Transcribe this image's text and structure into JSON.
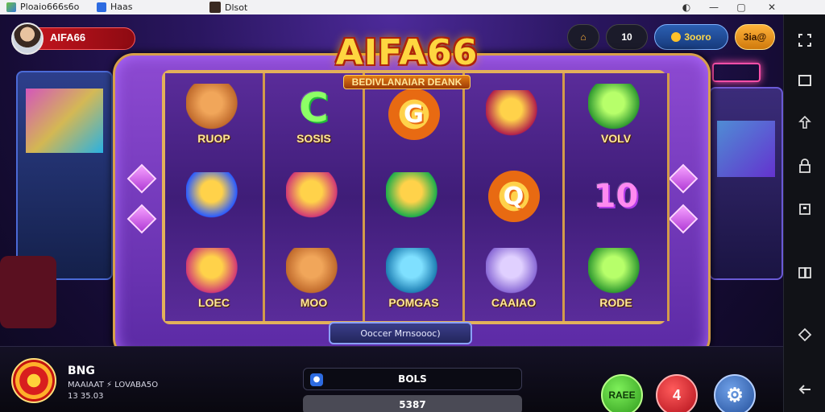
{
  "window": {
    "tabs": [
      {
        "label": "Ploaio666s6o"
      },
      {
        "label": "Haas"
      },
      {
        "label": "Dlsot"
      }
    ],
    "controls": [
      "◐",
      "—",
      "▢",
      "✕"
    ]
  },
  "header": {
    "user_name": "AIFA66",
    "coin_value": "10",
    "balance": "3ooro",
    "action_label": "3ia@"
  },
  "logo": {
    "title": "AIFA66",
    "subtitle": "BEDIVLANAIAR DEANK"
  },
  "reels": [
    {
      "cells": [
        {
          "label": "RUOP",
          "icon": "squirrel-icon"
        },
        {
          "label": "",
          "icon": "banner-icon"
        },
        {
          "label": "LOEC",
          "icon": "scroll-icon"
        }
      ]
    },
    {
      "cells": [
        {
          "label": "SOSIS",
          "icon": "letter-c-icon",
          "glyph": "C"
        },
        {
          "label": "",
          "icon": "scroll-icon"
        },
        {
          "label": "MOO",
          "icon": "squirrel-icon"
        }
      ]
    },
    {
      "cells": [
        {
          "label": "",
          "icon": "badge-icon",
          "glyph": "G"
        },
        {
          "label": "",
          "icon": "coin-icon"
        },
        {
          "label": "POMGAS",
          "icon": "drum-icon"
        }
      ]
    },
    {
      "cells": [
        {
          "label": "",
          "icon": "guitar-icon"
        },
        {
          "label": "",
          "icon": "badge-icon",
          "glyph": "Q"
        },
        {
          "label": "CAAIAO",
          "icon": "cat-icon"
        }
      ]
    },
    {
      "cells": [
        {
          "label": "VOLV",
          "icon": "dragon-icon"
        },
        {
          "label": "",
          "icon": "number-icon",
          "glyph": "10"
        },
        {
          "label": "RODE",
          "icon": "dragon-icon"
        }
      ]
    }
  ],
  "bottom": {
    "info_title": "BNG",
    "info_line1": "MAAIAAT ⚡ LOVABA5O",
    "info_line2": "13 35.03",
    "status_banner": "Ooccer Mrnsoooc)",
    "field1": "BOLS",
    "field2": "5387",
    "btn_green": "RAEE",
    "btn_red": "4"
  },
  "colors": {
    "accent": "#d8a04a",
    "spin_green": "#3fbf2f",
    "red": "#d8202d",
    "blue": "#3b6fb7"
  }
}
